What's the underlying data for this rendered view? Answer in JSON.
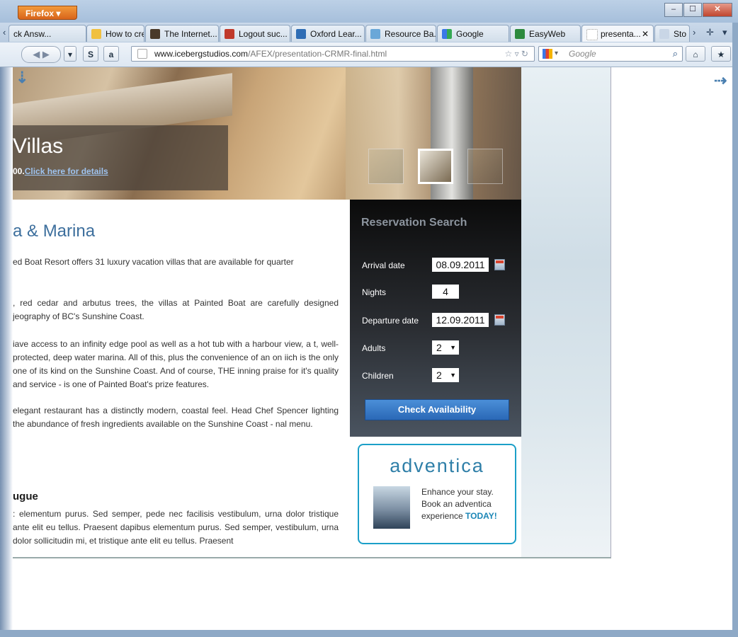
{
  "browser": {
    "app_button": "Firefox",
    "tabs": [
      {
        "label": "ck Answ..."
      },
      {
        "label": "How to crea..."
      },
      {
        "label": "The Internet..."
      },
      {
        "label": "Logout suc..."
      },
      {
        "label": "Oxford Lear..."
      },
      {
        "label": "Resource Ba..."
      },
      {
        "label": "Google"
      },
      {
        "label": "EasyWeb"
      },
      {
        "label": "presenta..."
      },
      {
        "label": "Sto"
      }
    ],
    "url_domain": "www.icebergstudios.com",
    "url_path": "/AFEX/presentation-CRMR-final.html",
    "search_placeholder": "Google"
  },
  "hero": {
    "title": "Villas",
    "sub_prefix": "00.",
    "link": "Click here for details"
  },
  "article": {
    "heading": "a & Marina",
    "paragraphs": [
      "ed Boat Resort offers 31 luxury vacation villas that are available for quarter",
      ", red cedar and arbutus trees, the villas at Painted Boat are carefully designed jeography of BC's Sunshine Coast.",
      "iave access to an infinity edge pool as well as a hot tub with a harbour view, a t, well-protected, deep water marina. All of this, plus the convenience of an on iich is the only one of its kind on the Sunshine Coast. And of course, THE inning praise for it's quality and service - is one of Painted Boat's prize features.",
      "elegant restaurant has a distinctly modern, coastal feel. Head Chef Spencer lighting the abundance of fresh ingredients available on the Sunshine Coast - nal menu."
    ],
    "subheading": "ugue",
    "lorem": ": elementum purus. Sed semper, pede nec facilisis vestibulum, urna dolor tristique ante elit eu tellus. Praesent dapibus elementum purus. Sed semper, vestibulum, urna dolor sollicitudin mi, et tristique ante elit eu tellus. Praesent"
  },
  "reservation": {
    "title": "Reservation Search",
    "arrival_label": "Arrival date",
    "arrival_value": "08.09.2011",
    "nights_label": "Nights",
    "nights_value": "4",
    "departure_label": "Departure date",
    "departure_value": "12.09.2011",
    "adults_label": "Adults",
    "adults_value": "2",
    "children_label": "Children",
    "children_value": "2",
    "button": "Check Availability"
  },
  "ad": {
    "logo": "adventica",
    "line1": "Enhance your stay.",
    "line2": "Book an adventica",
    "line3_prefix": "experience ",
    "line3_bold": "TODAY!"
  }
}
